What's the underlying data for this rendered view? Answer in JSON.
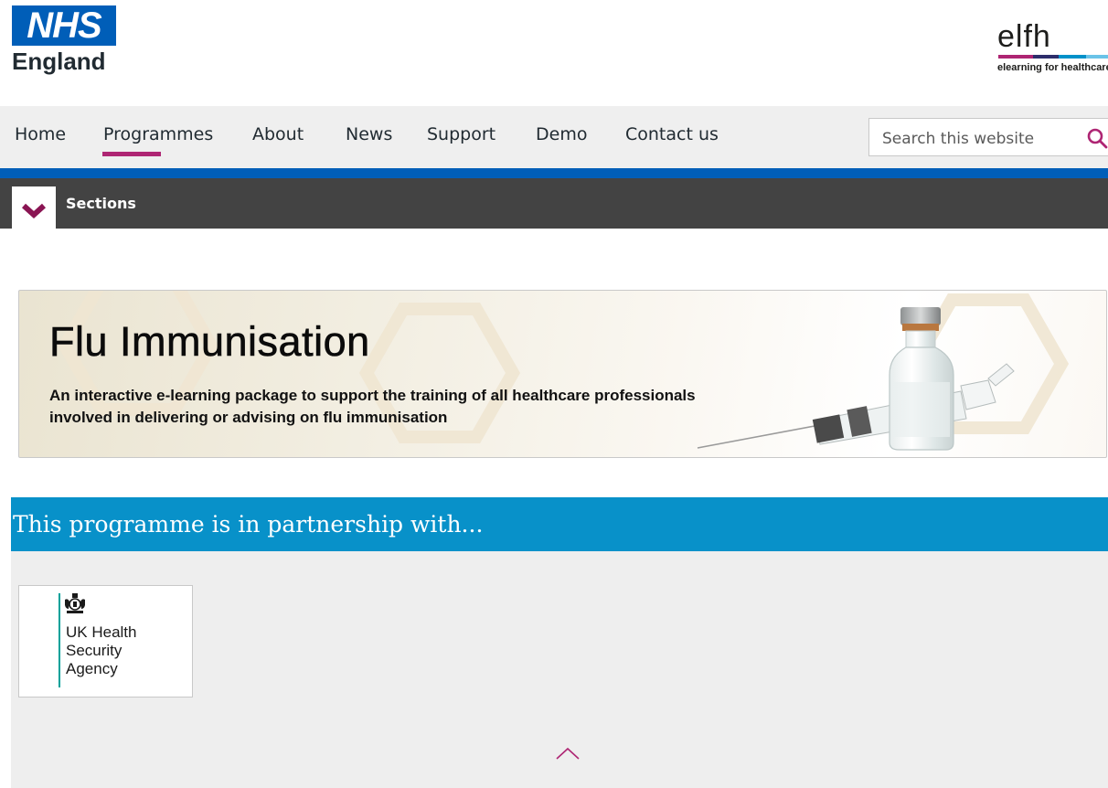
{
  "header": {
    "nhs_logo": {
      "mark": "NHS",
      "region": "England"
    },
    "elfh_logo": {
      "wordmark": "elfh",
      "tagline": "elearning for healthcare"
    }
  },
  "nav": {
    "items": [
      {
        "label": "Home"
      },
      {
        "label": "Programmes",
        "active": true
      },
      {
        "label": "About"
      },
      {
        "label": "News"
      },
      {
        "label": "Support"
      },
      {
        "label": "Demo"
      },
      {
        "label": "Contact us"
      }
    ],
    "search": {
      "placeholder": "Search this website",
      "icon": "search-icon"
    }
  },
  "sections": {
    "label": "Sections",
    "icon": "chevron-down-icon"
  },
  "banner": {
    "title": "Flu Immunisation",
    "description": "An interactive e-learning package to support the training of all healthcare professionals involved in delivering or advising on flu immunisation"
  },
  "partnership": {
    "heading": "This programme is in partnership with...",
    "partner": {
      "name_lines": [
        "UK Health",
        "Security",
        "Agency"
      ],
      "icon": "royal-crest-icon"
    },
    "back_to_top_icon": "chevron-up-icon"
  },
  "colors": {
    "nhs_blue": "#005eb8",
    "accent_magenta": "#ae2573",
    "sections_bar": "#434343",
    "partnership_heading": "#0891c9",
    "ukhsa_teal": "#00a19a"
  }
}
